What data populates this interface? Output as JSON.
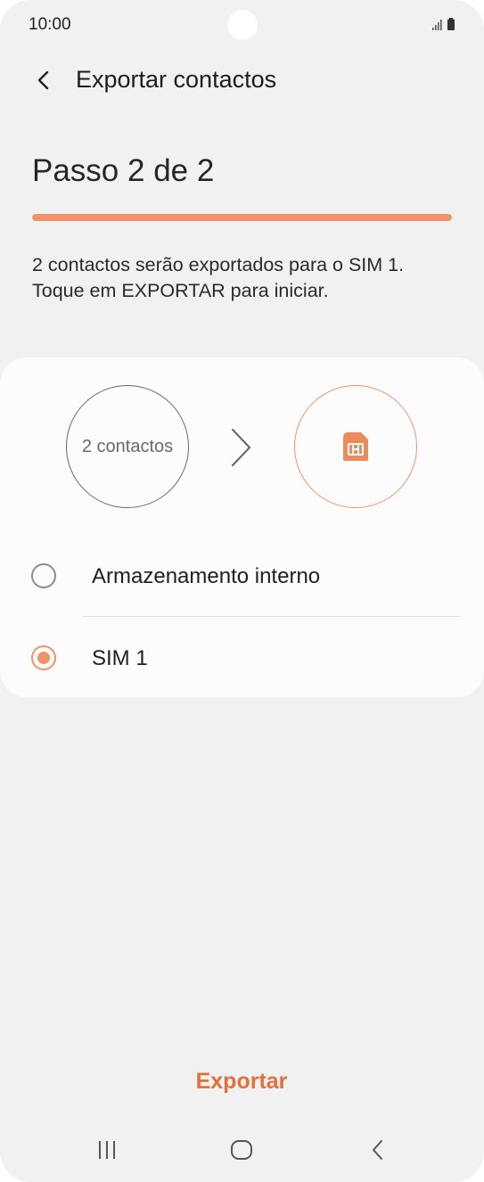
{
  "status_bar": {
    "time": "10:00",
    "icons": [
      "signal-icon",
      "battery-icon"
    ]
  },
  "app_bar": {
    "back_icon": "back-arrow-icon",
    "title": "Exportar contactos"
  },
  "step": {
    "title": "Passo 2 de 2",
    "progress": 1.0
  },
  "description": {
    "line1": "2 contactos serão exportados para o SIM 1.",
    "line2": "Toque em EXPORTAR para iniciar."
  },
  "transfer": {
    "source_label": "2 contactos",
    "arrow_icon": "chevron-right-icon",
    "target_icon": "sim-card-icon"
  },
  "options": [
    {
      "label": "Armazenamento interno",
      "selected": false
    },
    {
      "label": "SIM 1",
      "selected": true
    }
  ],
  "action": {
    "export_label": "Exportar"
  },
  "nav_bar": {
    "buttons": [
      "recents-icon",
      "home-icon",
      "back-icon"
    ]
  },
  "colors": {
    "accent": "#f0936a",
    "action_text": "#e0713a",
    "background": "#f1f1f1",
    "card": "#fcfcfc"
  }
}
